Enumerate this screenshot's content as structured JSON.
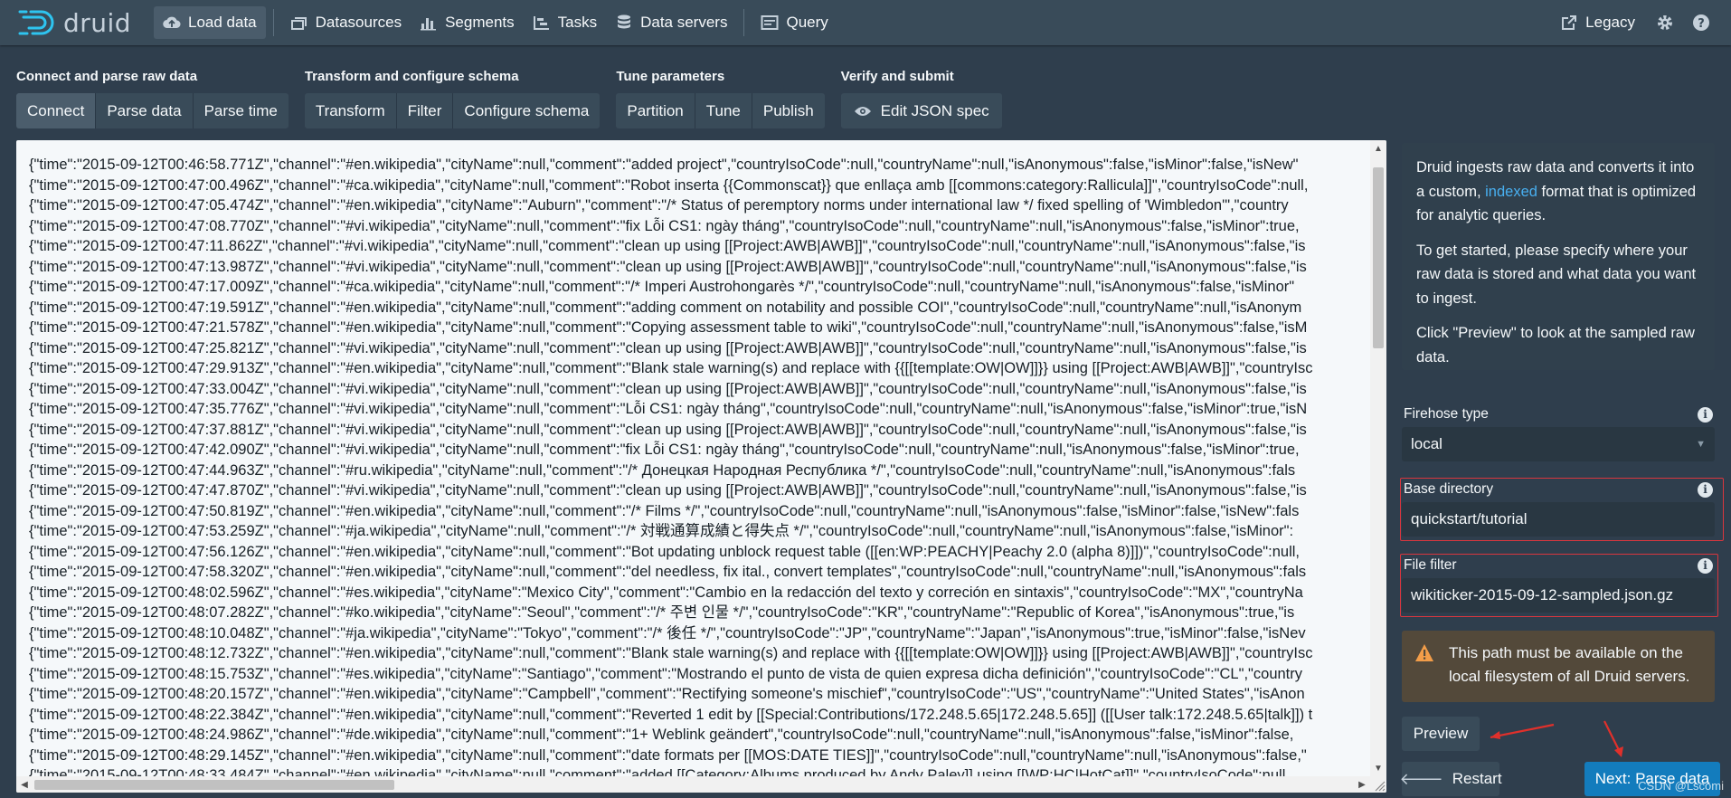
{
  "nav": {
    "logo_text": "druid",
    "items": [
      {
        "label": "Load data",
        "icon": "cloud-upload-icon",
        "active": true
      },
      {
        "label": "Datasources",
        "icon": "datasources-icon",
        "active": false
      },
      {
        "label": "Segments",
        "icon": "segments-icon",
        "active": false
      },
      {
        "label": "Tasks",
        "icon": "tasks-icon",
        "active": false
      },
      {
        "label": "Data servers",
        "icon": "database-icon",
        "active": false
      },
      {
        "label": "Query",
        "icon": "query-icon",
        "active": false
      }
    ],
    "legacy_label": "Legacy"
  },
  "steps": {
    "groups": [
      {
        "title": "Connect and parse raw data",
        "items": [
          "Connect",
          "Parse data",
          "Parse time"
        ]
      },
      {
        "title": "Transform and configure schema",
        "items": [
          "Transform",
          "Filter",
          "Configure schema"
        ]
      },
      {
        "title": "Tune parameters",
        "items": [
          "Partition",
          "Tune",
          "Publish"
        ]
      },
      {
        "title": "Verify and submit",
        "items": [
          "Edit JSON spec"
        ]
      }
    ],
    "active": "Connect"
  },
  "raw_data": {
    "lines": [
      "{\"time\":\"2015-09-12T00:46:58.771Z\",\"channel\":\"#en.wikipedia\",\"cityName\":null,\"comment\":\"added project\",\"countryIsoCode\":null,\"countryName\":null,\"isAnonymous\":false,\"isMinor\":false,\"isNew\"",
      "{\"time\":\"2015-09-12T00:47:00.496Z\",\"channel\":\"#ca.wikipedia\",\"cityName\":null,\"comment\":\"Robot inserta {{Commonscat}} que enllaça amb [[commons:category:Rallicula]]\",\"countryIsoCode\":null,",
      "{\"time\":\"2015-09-12T00:47:05.474Z\",\"channel\":\"#en.wikipedia\",\"cityName\":\"Auburn\",\"comment\":\"/* Status of peremptory norms under international law */ fixed spelling of 'Wimbledon'\",\"country",
      "{\"time\":\"2015-09-12T00:47:08.770Z\",\"channel\":\"#vi.wikipedia\",\"cityName\":null,\"comment\":\"fix Lỗi CS1: ngày tháng\",\"countryIsoCode\":null,\"countryName\":null,\"isAnonymous\":false,\"isMinor\":true,",
      "{\"time\":\"2015-09-12T00:47:11.862Z\",\"channel\":\"#vi.wikipedia\",\"cityName\":null,\"comment\":\"clean up using [[Project:AWB|AWB]]\",\"countryIsoCode\":null,\"countryName\":null,\"isAnonymous\":false,\"is",
      "{\"time\":\"2015-09-12T00:47:13.987Z\",\"channel\":\"#vi.wikipedia\",\"cityName\":null,\"comment\":\"clean up using [[Project:AWB|AWB]]\",\"countryIsoCode\":null,\"countryName\":null,\"isAnonymous\":false,\"is",
      "{\"time\":\"2015-09-12T00:47:17.009Z\",\"channel\":\"#ca.wikipedia\",\"cityName\":null,\"comment\":\"/* Imperi Austrohongarès */\",\"countryIsoCode\":null,\"countryName\":null,\"isAnonymous\":false,\"isMinor\"",
      "{\"time\":\"2015-09-12T00:47:19.591Z\",\"channel\":\"#en.wikipedia\",\"cityName\":null,\"comment\":\"adding comment on notability and possible COI\",\"countryIsoCode\":null,\"countryName\":null,\"isAnonym",
      "{\"time\":\"2015-09-12T00:47:21.578Z\",\"channel\":\"#en.wikipedia\",\"cityName\":null,\"comment\":\"Copying assessment table to wiki\",\"countryIsoCode\":null,\"countryName\":null,\"isAnonymous\":false,\"isM",
      "{\"time\":\"2015-09-12T00:47:25.821Z\",\"channel\":\"#vi.wikipedia\",\"cityName\":null,\"comment\":\"clean up using [[Project:AWB|AWB]]\",\"countryIsoCode\":null,\"countryName\":null,\"isAnonymous\":false,\"is",
      "{\"time\":\"2015-09-12T00:47:29.913Z\",\"channel\":\"#en.wikipedia\",\"cityName\":null,\"comment\":\"Blank stale warning(s) and replace with {{[[template:OW|OW]]}} using [[Project:AWB|AWB]]\",\"countryIsc",
      "{\"time\":\"2015-09-12T00:47:33.004Z\",\"channel\":\"#vi.wikipedia\",\"cityName\":null,\"comment\":\"clean up using [[Project:AWB|AWB]]\",\"countryIsoCode\":null,\"countryName\":null,\"isAnonymous\":false,\"is",
      "{\"time\":\"2015-09-12T00:47:35.776Z\",\"channel\":\"#vi.wikipedia\",\"cityName\":null,\"comment\":\"Lỗi CS1: ngày tháng\",\"countryIsoCode\":null,\"countryName\":null,\"isAnonymous\":false,\"isMinor\":true,\"isN",
      "{\"time\":\"2015-09-12T00:47:37.881Z\",\"channel\":\"#vi.wikipedia\",\"cityName\":null,\"comment\":\"clean up using [[Project:AWB|AWB]]\",\"countryIsoCode\":null,\"countryName\":null,\"isAnonymous\":false,\"is",
      "{\"time\":\"2015-09-12T00:47:42.090Z\",\"channel\":\"#vi.wikipedia\",\"cityName\":null,\"comment\":\"fix Lỗi CS1: ngày tháng\",\"countryIsoCode\":null,\"countryName\":null,\"isAnonymous\":false,\"isMinor\":true,",
      "{\"time\":\"2015-09-12T00:47:44.963Z\",\"channel\":\"#ru.wikipedia\",\"cityName\":null,\"comment\":\"/* Донецкая Народная Республика */\",\"countryIsoCode\":null,\"countryName\":null,\"isAnonymous\":fals",
      "{\"time\":\"2015-09-12T00:47:47.870Z\",\"channel\":\"#vi.wikipedia\",\"cityName\":null,\"comment\":\"clean up using [[Project:AWB|AWB]]\",\"countryIsoCode\":null,\"countryName\":null,\"isAnonymous\":false,\"is",
      "{\"time\":\"2015-09-12T00:47:50.819Z\",\"channel\":\"#en.wikipedia\",\"cityName\":null,\"comment\":\"/* Films */\",\"countryIsoCode\":null,\"countryName\":null,\"isAnonymous\":false,\"isMinor\":false,\"isNew\":fals",
      "{\"time\":\"2015-09-12T00:47:53.259Z\",\"channel\":\"#ja.wikipedia\",\"cityName\":null,\"comment\":\"/* 対戦通算成績と得失点 */\",\"countryIsoCode\":null,\"countryName\":null,\"isAnonymous\":false,\"isMinor\":",
      "{\"time\":\"2015-09-12T00:47:56.126Z\",\"channel\":\"#en.wikipedia\",\"cityName\":null,\"comment\":\"Bot updating unblock request table ([[en:WP:PEACHY|Peachy 2.0 (alpha 8)]])\",\"countryIsoCode\":null,",
      "{\"time\":\"2015-09-12T00:47:58.320Z\",\"channel\":\"#en.wikipedia\",\"cityName\":null,\"comment\":\"del needless, fix ital., convert templates\",\"countryIsoCode\":null,\"countryName\":null,\"isAnonymous\":fals",
      "{\"time\":\"2015-09-12T00:48:02.596Z\",\"channel\":\"#es.wikipedia\",\"cityName\":\"Mexico City\",\"comment\":\"Cambio en la redacción del texto y correción en sintaxis\",\"countryIsoCode\":\"MX\",\"countryNa",
      "{\"time\":\"2015-09-12T00:48:07.282Z\",\"channel\":\"#ko.wikipedia\",\"cityName\":\"Seoul\",\"comment\":\"/* 주변 인물 */\",\"countryIsoCode\":\"KR\",\"countryName\":\"Republic of Korea\",\"isAnonymous\":true,\"is",
      "{\"time\":\"2015-09-12T00:48:10.048Z\",\"channel\":\"#ja.wikipedia\",\"cityName\":\"Tokyo\",\"comment\":\"/* 後任 */\",\"countryIsoCode\":\"JP\",\"countryName\":\"Japan\",\"isAnonymous\":true,\"isMinor\":false,\"isNev",
      "{\"time\":\"2015-09-12T00:48:12.732Z\",\"channel\":\"#en.wikipedia\",\"cityName\":null,\"comment\":\"Blank stale warning(s) and replace with {{[[template:OW|OW]]}} using [[Project:AWB|AWB]]\",\"countryIsc",
      "{\"time\":\"2015-09-12T00:48:15.753Z\",\"channel\":\"#es.wikipedia\",\"cityName\":\"Santiago\",\"comment\":\"Mostrando el punto de vista de quien expresa dicha definición\",\"countryIsoCode\":\"CL\",\"country",
      "{\"time\":\"2015-09-12T00:48:20.157Z\",\"channel\":\"#en.wikipedia\",\"cityName\":\"Campbell\",\"comment\":\"Rectifying someone's mischief\",\"countryIsoCode\":\"US\",\"countryName\":\"United States\",\"isAnon",
      "{\"time\":\"2015-09-12T00:48:22.384Z\",\"channel\":\"#en.wikipedia\",\"cityName\":null,\"comment\":\"Reverted 1 edit by [[Special:Contributions/172.248.5.65|172.248.5.65]] ([[User talk:172.248.5.65|talk]]) t",
      "{\"time\":\"2015-09-12T00:48:24.986Z\",\"channel\":\"#de.wikipedia\",\"cityName\":null,\"comment\":\"1+ Weblink geändert\",\"countryIsoCode\":null,\"countryName\":null,\"isAnonymous\":false,\"isMinor\":false,",
      "{\"time\":\"2015-09-12T00:48:29.145Z\",\"channel\":\"#en.wikipedia\",\"cityName\":null,\"comment\":\"date formats per [[MOS:DATE TIES]]\",\"countryIsoCode\":null,\"countryName\":null,\"isAnonymous\":false,\"",
      "{\"time\":\"2015-09-12T00:48:33.484Z\",\"channel\":\"#en.wikipedia\",\"cityName\":null,\"comment\":\"added [[Category:Albums produced by Andy Paley]] using [[WP:HC|HotCat]]\",\"countryIsoCode\":null,"
    ]
  },
  "sidebar": {
    "info_p1_before": "Druid ingests raw data and converts it into a custom, ",
    "info_p1_link": "indexed",
    "info_p1_after": " format that is optimized for analytic queries.",
    "info_p2": "To get started, please specify where your raw data is stored and what data you want to ingest.",
    "info_p3": "Click \"Preview\" to look at the sampled raw data.",
    "firehose_label": "Firehose type",
    "firehose_value": "local",
    "base_dir_label": "Base directory",
    "base_dir_value": "quickstart/tutorial",
    "file_filter_label": "File filter",
    "file_filter_value": "wikiticker-2015-09-12-sampled.json.gz",
    "callout_text": "This path must be available on the local filesystem of all Druid servers.",
    "preview_label": "Preview",
    "restart_label": "Restart",
    "next_label": "Next: Parse data"
  },
  "watermark": "CSDN @Lscomi",
  "colors": {
    "accent": "#137cbd",
    "annotation": "#d9363e",
    "link": "#48aff0"
  }
}
